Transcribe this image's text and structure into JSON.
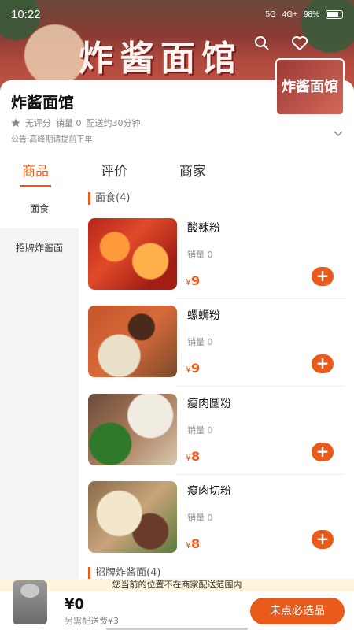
{
  "status_bar": {
    "time": "10:22",
    "network": "5G",
    "signal": "4G+",
    "battery": "98%"
  },
  "banner": {
    "sign_text": "炸酱面馆"
  },
  "shop": {
    "name": "炸酱面馆",
    "rating": "无评分",
    "sales": "销量 0",
    "delivery": "配送约30分钟",
    "notice": "公告:高峰期请提前下单!",
    "logo_text": "炸酱面馆"
  },
  "tabs": [
    {
      "label": "商品"
    },
    {
      "label": "评价"
    },
    {
      "label": "商家"
    }
  ],
  "sidebar": {
    "items": [
      {
        "label": "面食"
      },
      {
        "label": "招牌炸酱面"
      }
    ]
  },
  "sections": [
    {
      "title": "面食(4)",
      "items": [
        {
          "name": "酸辣粉",
          "sales": "销量 0",
          "price_symbol": "¥",
          "price": "9"
        },
        {
          "name": "螺蛳粉",
          "sales": "销量 0",
          "price_symbol": "¥",
          "price": "9"
        },
        {
          "name": "瘦肉圆粉",
          "sales": "销量 0",
          "price_symbol": "¥",
          "price": "8"
        },
        {
          "name": "瘦肉切粉",
          "sales": "销量 0",
          "price_symbol": "¥",
          "price": "8"
        }
      ]
    },
    {
      "title": "招牌炸酱面(4)"
    }
  ],
  "notice_bar": "您当前的位置不在商家配送范围内",
  "cart": {
    "total": "¥0",
    "delivery_fee": "另需配送费¥3",
    "checkout_label": "未点必选品"
  },
  "icons": {
    "search": "search-icon",
    "favorite": "heart-icon",
    "rating": "star-icon",
    "expand": "chevron-down-icon",
    "add": "plus-icon",
    "cart": "cart-icon"
  },
  "colors": {
    "accent": "#ea5a1a",
    "notice_bg": "#fff5dc"
  }
}
